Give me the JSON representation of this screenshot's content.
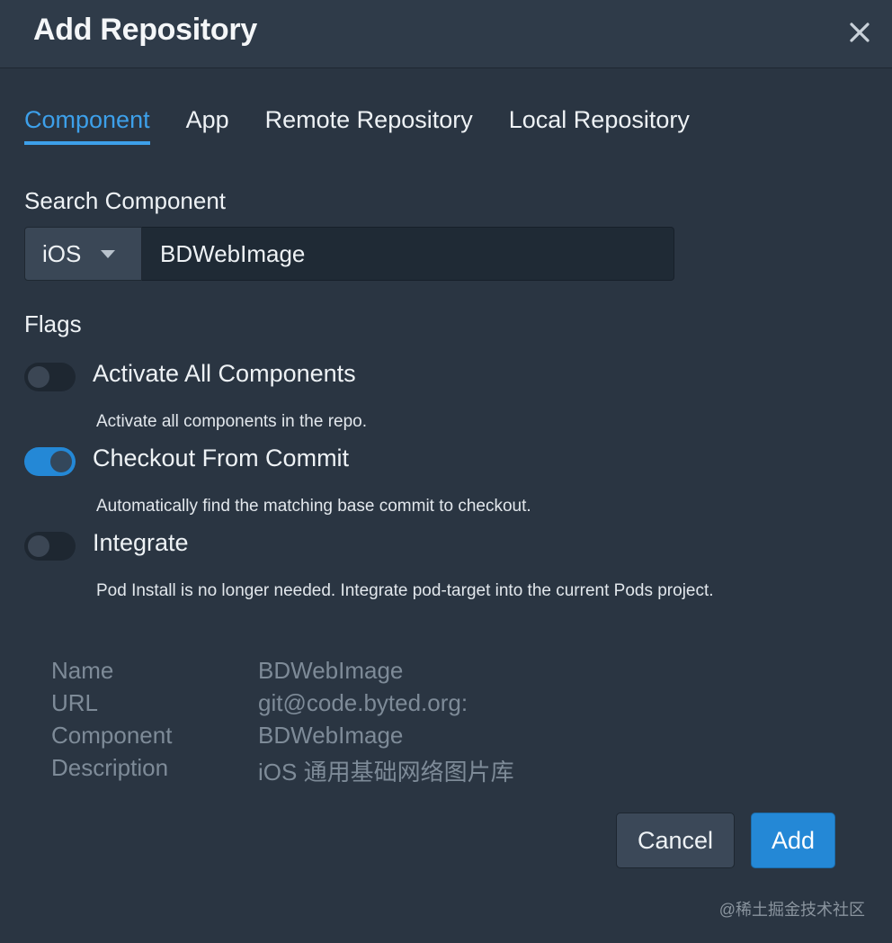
{
  "dialog": {
    "title": "Add Repository",
    "close_icon": "close-icon"
  },
  "tabs": [
    {
      "label": "Component",
      "active": true
    },
    {
      "label": "App",
      "active": false
    },
    {
      "label": "Remote Repository",
      "active": false
    },
    {
      "label": "Local Repository",
      "active": false
    }
  ],
  "search": {
    "label": "Search Component",
    "platform": "iOS",
    "value": "BDWebImage"
  },
  "flags": {
    "label": "Flags",
    "items": [
      {
        "title": "Activate All Components",
        "description": "Activate all components in the repo.",
        "enabled": false
      },
      {
        "title": "Checkout From Commit",
        "description": "Automatically find the matching base commit to checkout.",
        "enabled": true
      },
      {
        "title": "Integrate",
        "description": "Pod Install is no longer needed. Integrate pod-target into the current Pods project.",
        "enabled": false
      }
    ]
  },
  "info": [
    {
      "key": "Name",
      "value": "BDWebImage"
    },
    {
      "key": "URL",
      "value": "git@code.byted.org:"
    },
    {
      "key": "Component",
      "value": "BDWebImage"
    },
    {
      "key": "Description",
      "value": "iOS 通用基础网络图片库"
    }
  ],
  "buttons": {
    "cancel": "Cancel",
    "add": "Add"
  },
  "watermark": "@稀土掘金技术社区",
  "colors": {
    "accent": "#3da0ea",
    "toggle_on": "#2488d6",
    "background": "#2a3542"
  }
}
